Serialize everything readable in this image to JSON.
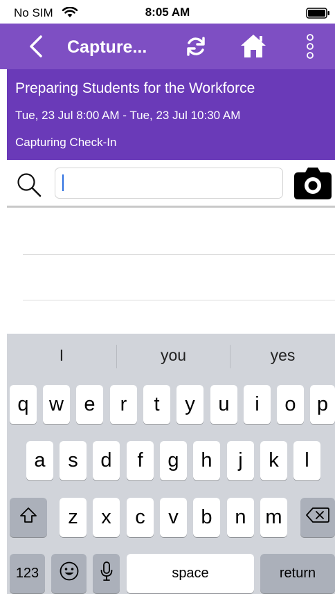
{
  "status_bar": {
    "carrier": "No SIM",
    "time": "8:05 AM"
  },
  "nav": {
    "title": "Capture..."
  },
  "event": {
    "title": "Preparing Students for the Workforce",
    "time_range": "Tue, 23 Jul 8:00 AM - Tue, 23 Jul 10:30 AM",
    "status": "Capturing Check-In"
  },
  "search": {
    "value": "",
    "placeholder": ""
  },
  "keyboard": {
    "suggestions": [
      "I",
      "you",
      "yes"
    ],
    "row1": [
      "q",
      "w",
      "e",
      "r",
      "t",
      "y",
      "u",
      "i",
      "o",
      "p"
    ],
    "row2": [
      "a",
      "s",
      "d",
      "f",
      "g",
      "h",
      "j",
      "k",
      "l"
    ],
    "row3": [
      "z",
      "x",
      "c",
      "v",
      "b",
      "n",
      "m"
    ],
    "numbers_label": "123",
    "space_label": "space",
    "return_label": "return"
  },
  "icons": {
    "back": "chevron-left-icon",
    "refresh": "refresh-icon",
    "home": "home-icon",
    "more": "more-vertical-icon",
    "search": "search-icon",
    "camera": "camera-icon",
    "shift": "shift-icon",
    "delete": "delete-icon",
    "emoji": "emoji-icon",
    "mic": "microphone-icon"
  },
  "colors": {
    "nav_bar": "#7e4fc3",
    "event_info": "#6a3ab8",
    "keyboard": "#d1d4da"
  }
}
